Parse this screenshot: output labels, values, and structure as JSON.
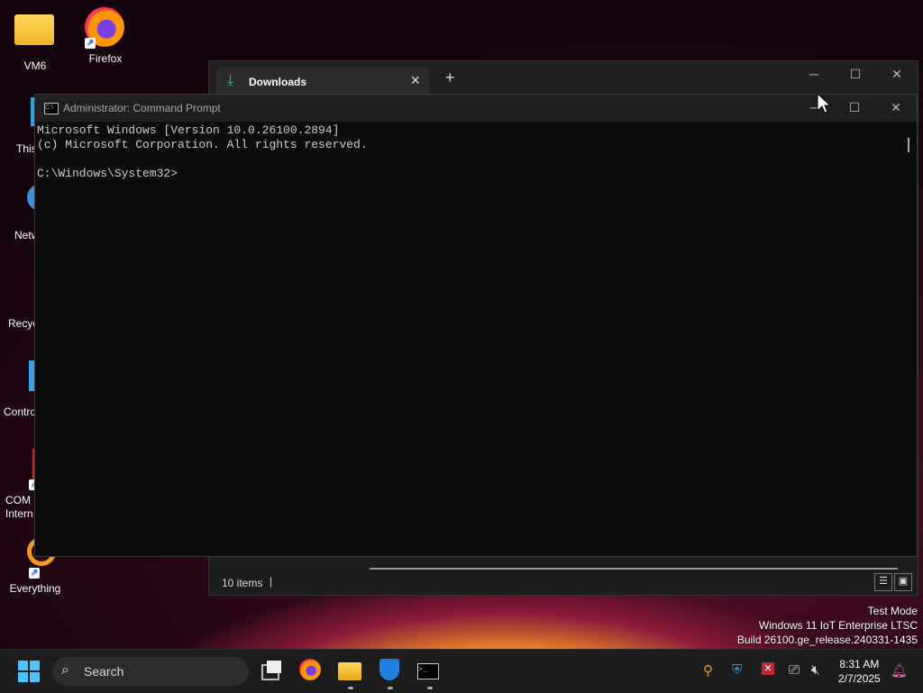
{
  "desktop": {
    "icons": [
      {
        "label": "VM6"
      },
      {
        "label": "Firefox"
      },
      {
        "label": "This"
      },
      {
        "label": "Netw"
      },
      {
        "label": "Recyc"
      },
      {
        "label": "Contro"
      },
      {
        "label": "COM Intern"
      },
      {
        "label": "Everything"
      }
    ],
    "watermark": {
      "line1": "Test Mode",
      "line2": "Windows 11 IoT Enterprise LTSC",
      "line3": "Build 26100.ge_release.240331-1435"
    }
  },
  "explorer": {
    "tab_title": "Downloads",
    "status_count": "10 items"
  },
  "cmd": {
    "title": "Administrator: Command Prompt",
    "lines": [
      "Microsoft Windows [Version 10.0.26100.2894]",
      "(c) Microsoft Corporation. All rights reserved.",
      "",
      "C:\\Windows\\System32>"
    ]
  },
  "taskbar": {
    "search_placeholder": "Search",
    "time": "8:31 AM",
    "date": "2/7/2025"
  }
}
